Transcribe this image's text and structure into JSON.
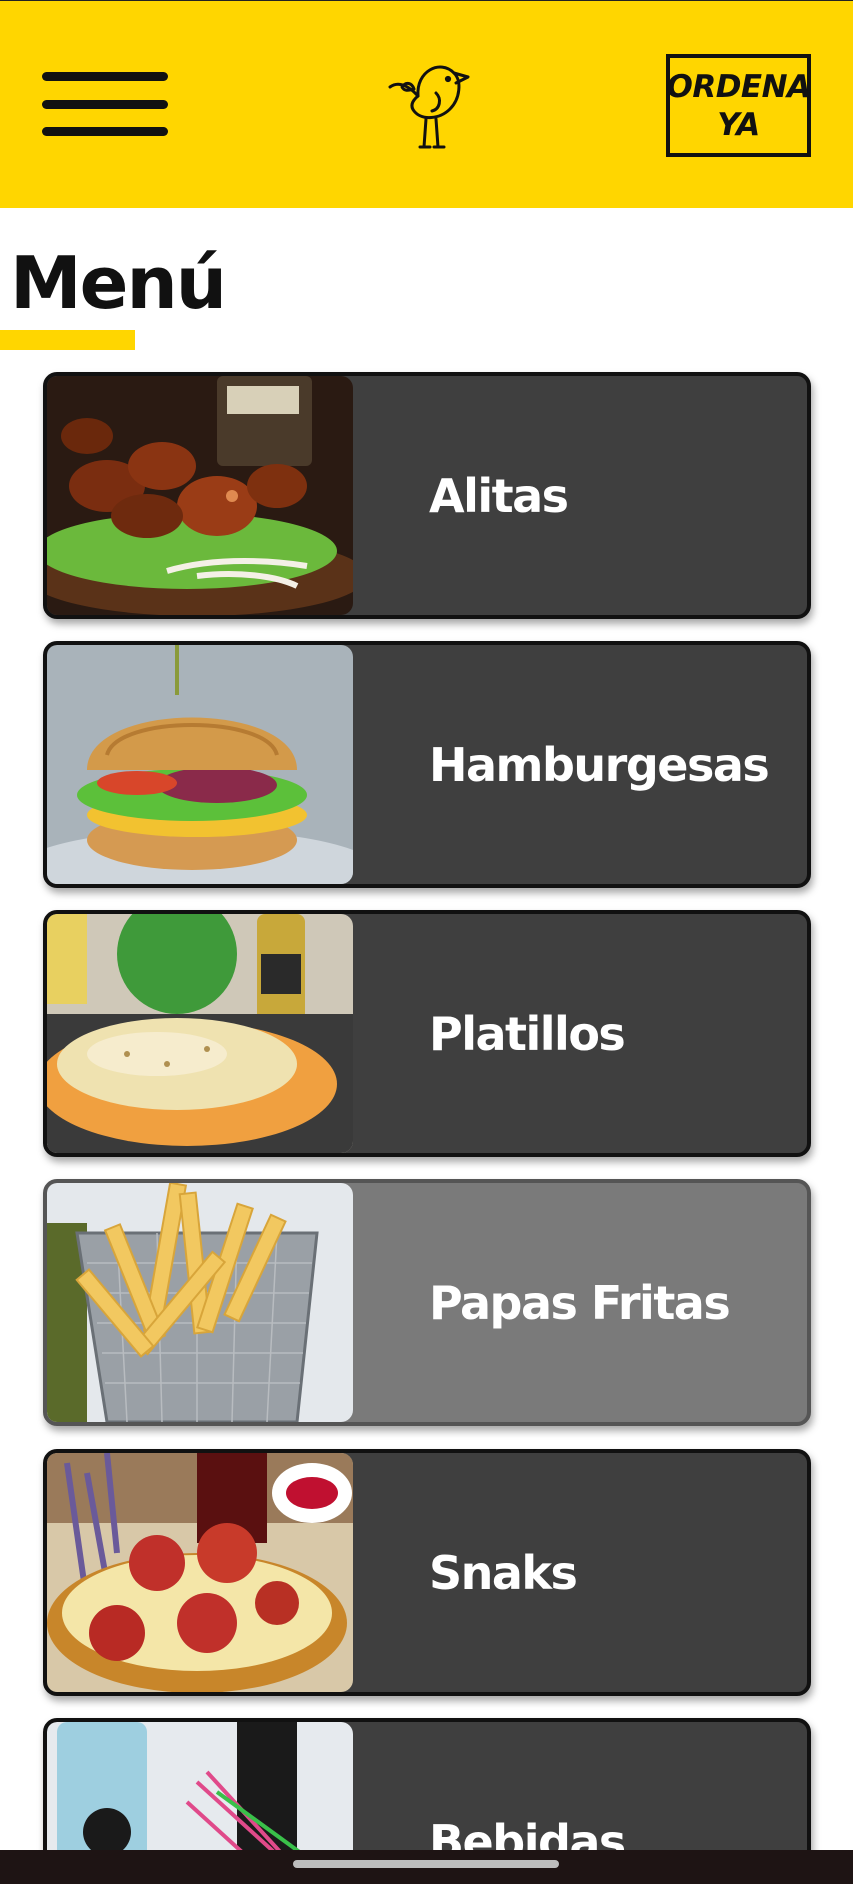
{
  "header": {
    "menu_icon": "hamburger-menu-icon",
    "logo_icon": "bird-logo-icon",
    "order_button_label": "ORDENA\nYA",
    "background_color": "#FFD600"
  },
  "page_title": "Menú",
  "menu": {
    "items": [
      {
        "label": "Alitas",
        "image": "chicken-wings-photo",
        "selected": false
      },
      {
        "label": "Hamburgesas",
        "image": "burger-photo",
        "selected": false
      },
      {
        "label": "Platillos",
        "image": "burrito-platter-photo",
        "selected": false
      },
      {
        "label": "Papas Fritas",
        "image": "french-fries-photo",
        "selected": true
      },
      {
        "label": "Snaks",
        "image": "pepperoni-pizza-photo",
        "selected": false
      },
      {
        "label": "Bebidas",
        "image": "drinks-photo",
        "selected": false
      }
    ]
  },
  "colors": {
    "accent": "#FFD600",
    "card": "#3f3f3f",
    "card_selected": "#7a7a7a",
    "text_on_card": "#ffffff"
  }
}
